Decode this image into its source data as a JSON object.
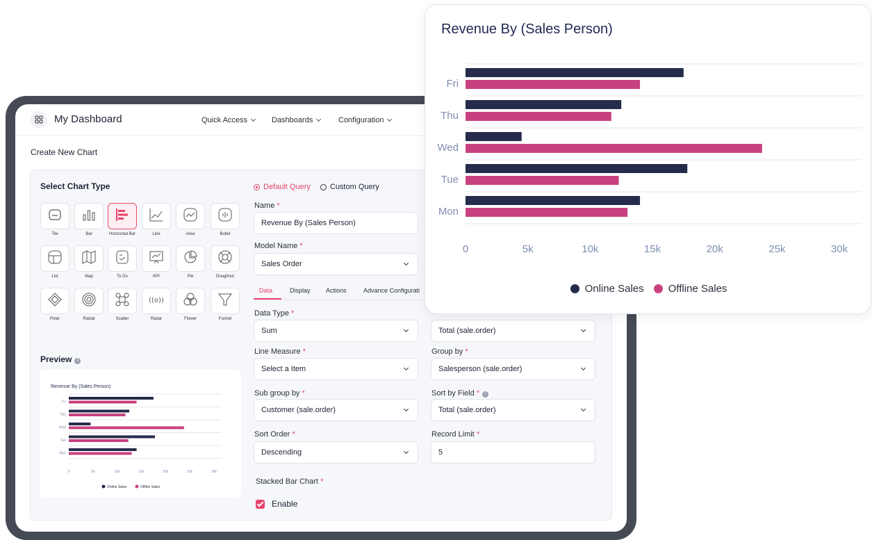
{
  "topbar": {
    "title": "My Dashboard",
    "nav": [
      "Quick Access",
      "Dashboards",
      "Configuration"
    ]
  },
  "page_title": "Create New Chart",
  "chart_types": {
    "title": "Select Chart Type",
    "selected": "Horizontal Bar",
    "items": [
      {
        "label": "Tile",
        "icon": "tile-icon"
      },
      {
        "label": "Bar",
        "icon": "bar-chart-icon"
      },
      {
        "label": "Horizontal Bar",
        "icon": "horizontal-bar-icon"
      },
      {
        "label": "Line",
        "icon": "line-chart-icon"
      },
      {
        "label": "Area",
        "icon": "area-chart-icon"
      },
      {
        "label": "Bullet",
        "icon": "bullet-chart-icon"
      },
      {
        "label": "List",
        "icon": "list-icon"
      },
      {
        "label": "Map",
        "icon": "map-icon"
      },
      {
        "label": "To Do",
        "icon": "todo-icon"
      },
      {
        "label": "KPI",
        "icon": "kpi-icon"
      },
      {
        "label": "Pie",
        "icon": "pie-chart-icon"
      },
      {
        "label": "Doughnut",
        "icon": "doughnut-icon"
      },
      {
        "label": "Polar",
        "icon": "polar-icon"
      },
      {
        "label": "Radial",
        "icon": "radial-icon"
      },
      {
        "label": "Scatter",
        "icon": "scatter-icon"
      },
      {
        "label": "Radar",
        "icon": "radar-icon"
      },
      {
        "label": "Flower",
        "icon": "flower-icon"
      },
      {
        "label": "Funnel",
        "icon": "funnel-icon"
      }
    ]
  },
  "preview": {
    "title": "Preview",
    "info": "i"
  },
  "query": {
    "options": [
      "Default Query",
      "Custom Query"
    ],
    "selected": "Default Query"
  },
  "form": {
    "name_label": "Name",
    "name_value": "Revenue By (Sales Person)",
    "model_label": "Model Name",
    "model_value": "Sales Order",
    "tabs": [
      "Data",
      "Display",
      "Actions",
      "Advance Configurati"
    ],
    "active_tab": "Data",
    "data_type_label": "Data Type",
    "data_type_value": "Sum",
    "measure_value": "Total (sale.order)",
    "line_measure_label": "Line Measure",
    "line_measure_value": "Select a Item",
    "group_by_label": "Group by",
    "group_by_value": "Salesperson (sale.order)",
    "sub_group_label": "Sub group by",
    "sub_group_value": "Customer (sale.order)",
    "sort_field_label": "Sort by Field",
    "sort_field_value": "Total  (sale.order)",
    "sort_order_label": "Sort Order",
    "sort_order_value": "Descending",
    "record_limit_label": "Record Limit",
    "record_limit_value": "5",
    "stacked_label": "Stacked Bar Chart",
    "enable_label": "Enable",
    "required_mark": "*"
  },
  "colors": {
    "online": "#252b4a",
    "offline": "#c8417f",
    "accent": "#e7436a"
  },
  "chart_data": {
    "type": "bar",
    "orientation": "horizontal",
    "title": "Revenue By (Sales Person)",
    "categories": [
      "Fri",
      "Thu",
      "Wed",
      "Tue",
      "Mon"
    ],
    "series": [
      {
        "name": "Online Sales",
        "values": [
          17500,
          12500,
          4500,
          17800,
          14000
        ]
      },
      {
        "name": "Offline Sales",
        "values": [
          14000,
          11700,
          23800,
          12300,
          13000
        ]
      }
    ],
    "xlim": [
      0,
      30000
    ],
    "xticks": [
      "0",
      "5k",
      "10k",
      "15k",
      "20k",
      "25k",
      "30k"
    ],
    "legend": "bottom"
  }
}
